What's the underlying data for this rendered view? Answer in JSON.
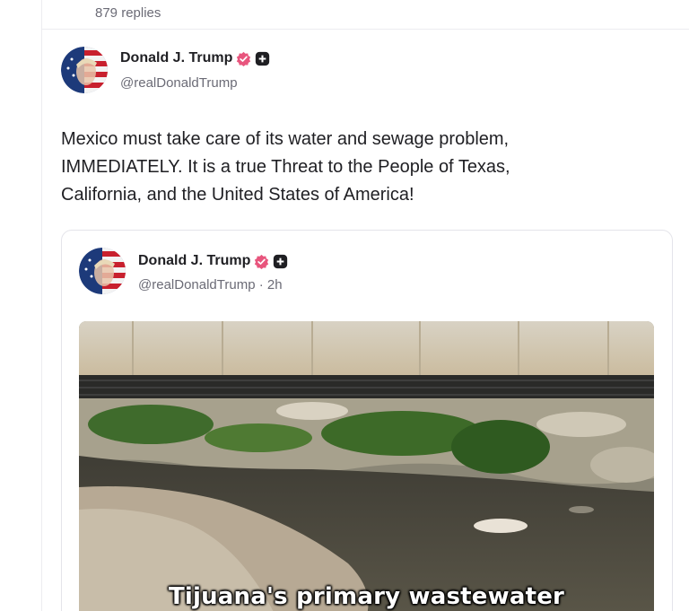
{
  "thread": {
    "replies_label": "879 replies"
  },
  "post": {
    "author": {
      "name": "Donald J. Trump",
      "handle": "@realDonaldTrump",
      "verified_color": "#e8557d",
      "plus_badge_color": "#1f1f23"
    },
    "text_lines": [
      "Mexico must take care of its water and sewage problem,",
      "IMMEDIATELY. It is a true Threat to the People of Texas,",
      "California, and the United States of America!"
    ],
    "quote": {
      "author": {
        "name": "Donald J. Trump",
        "handle": "@realDonaldTrump · 2h"
      },
      "media": {
        "caption": "Tijuana's primary wastewater"
      }
    }
  }
}
